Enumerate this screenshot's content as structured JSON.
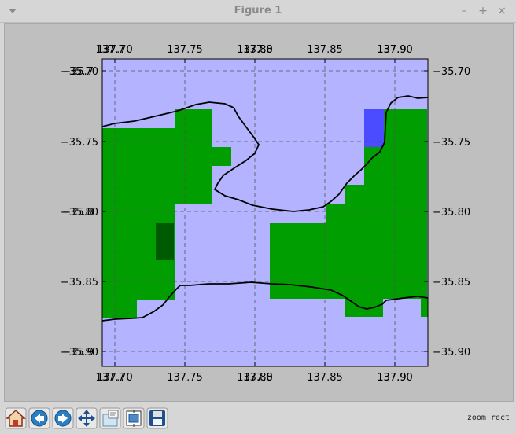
{
  "window": {
    "title": "Figure 1",
    "menu_icon": "chevron-down-icon",
    "minimize_label": "–",
    "maximize_label": "+",
    "close_label": "×"
  },
  "map": {
    "x_ticks_top": [
      "137.70",
      "137.75",
      "137.80",
      "137.85",
      "137.90"
    ],
    "x_ticks_top_overlap": [
      "137.7",
      "137.8",
      "137.9"
    ],
    "x_ticks_bottom": [
      "137.70",
      "137.75",
      "137.80",
      "137.85",
      "137.90"
    ],
    "x_ticks_bottom_overlap": [
      "137.7",
      "137.8",
      "137.9"
    ],
    "y_ticks_left": [
      "−35.70",
      "−35.75",
      "−35.80",
      "−35.85",
      "−35.90"
    ],
    "y_ticks_left_overlap": [
      "−35.7",
      "−35.8",
      "−35.9"
    ],
    "y_ticks_right": [
      "−35.70",
      "−35.75",
      "−35.80",
      "−35.85",
      "−35.90"
    ],
    "colors": {
      "water": "#b3b3ff",
      "land": "#009e00",
      "dark_land": "#005a00",
      "blue_cell": "#4b4bff",
      "coast": "#000000",
      "grid": "#555555"
    },
    "x_range": [
      137.692,
      137.923
    ],
    "y_range": [
      -35.911,
      -35.692
    ]
  },
  "toolbar": {
    "buttons": [
      {
        "name": "home-icon"
      },
      {
        "name": "back-icon"
      },
      {
        "name": "forward-icon"
      },
      {
        "name": "pan-icon"
      },
      {
        "name": "zoom-icon"
      },
      {
        "name": "subplots-icon"
      },
      {
        "name": "save-icon"
      }
    ],
    "status": "zoom rect"
  }
}
